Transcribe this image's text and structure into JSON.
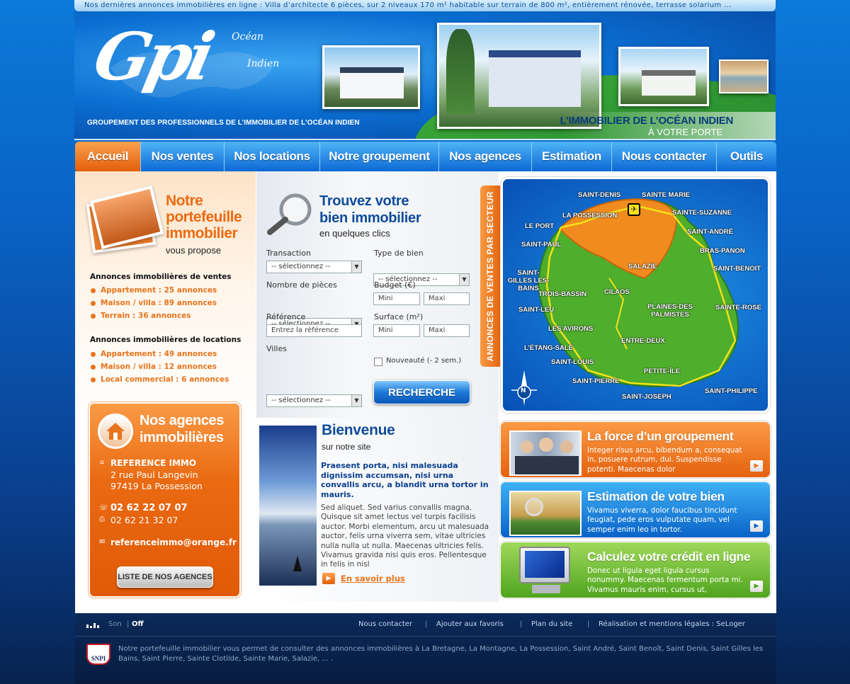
{
  "ticker": "Nos dernières annonces immobilières en ligne : Villa d’architecte 6 pièces, sur 2 niveaux 170 m² habitable sur terrain de 800 m², entièrement rénovée, terrasse solarium ...",
  "header": {
    "logo_text": "Gpi",
    "logo_ocean": "Océan",
    "logo_indien": "Indien",
    "tagline": "GROUPEMENT DES PROFESSIONNELS DE L’IMMOBILIER DE L’OCÉAN INDIEN",
    "slogan_line1": "L’IMMOBILIER DE L’OCÉAN INDIEN",
    "slogan_line2": "À VOTRE PORTE"
  },
  "nav": [
    "Accueil",
    "Nos ventes",
    "Nos locations",
    "Notre groupement",
    "Nos agences",
    "Estimation",
    "Nous contacter",
    "Outils"
  ],
  "portfolio": {
    "title_line1": "Notre",
    "title_line2": "portefeuille",
    "title_line3": "immobilier",
    "subtitle": "vous propose",
    "sales_title": "Annonces immobilières de ventes",
    "sales": [
      "Appartement : 25 annonces",
      "Maison / villa : 89 annonces",
      "Terrain : 36 annonces"
    ],
    "rentals_title": "Annonces immobilières de locations",
    "rentals": [
      "Appartement : 49 annonces",
      "Maison / villa : 12 annonces",
      "Local commercial : 6 annonces"
    ]
  },
  "agencies": {
    "title_line1": "Nos agences",
    "title_line2": "immobilières",
    "name": "REFERENCE IMMO",
    "address1": "2 rue Paul Langevin",
    "address2": "97419 La Possession",
    "phone": "02 62 22 07 07",
    "fax": "02 62 21 32 07",
    "email": "referenceimmo@orange.fr",
    "button": "LISTE DE NOS AGENCES"
  },
  "search": {
    "title_line1": "Trouvez votre",
    "title_line2": "bien immobilier",
    "subtitle": "en quelques clics",
    "transaction_label": "Transaction",
    "transaction_value": "-- sélectionnez --",
    "type_label": "Type de bien",
    "type_value": "-- sélectionnez --",
    "rooms_label": "Nombre de pièces",
    "rooms_value": "-- sélectionnez --",
    "budget_label": "Budget (€)",
    "budget_min": "Mini",
    "budget_max": "Maxi",
    "ref_label": "Référence",
    "ref_placeholder": "Entrez la référence",
    "surface_label": "Surface (m²)",
    "surface_min": "Mini",
    "surface_max": "Maxi",
    "cities_label": "Villes",
    "cities_value": "-- sélectionnez --",
    "new_label": "Nouveauté (- 2 sem.)",
    "button": "RECHERCHE"
  },
  "sector_tab": "ANNONCES DE VENTES  PAR SECTEUR",
  "map": {
    "cities": [
      "SAINT-DENIS",
      "SAINTE MARIE",
      "LA POSSESSION",
      "SAINTE-SUZANNE",
      "LE PORT",
      "SAINT-ANDRÉ",
      "SAINT-PAUL",
      "BRAS-PANON",
      "SALAZIE",
      "SAINT-BENOIT",
      "SAINT-GILLES LES-BAINS",
      "TROIS-BASSIN",
      "CILAOS",
      "SAINT-LEU",
      "PLAINES-DES PALMISTES",
      "SAINTE-ROSE",
      "LES AVIRONS",
      "ENTRE-DEUX",
      "L’ÉTANG-SALÉ",
      "SAINT-LOUIS",
      "PETITE-ÎLE",
      "SAINT-PIERRE",
      "SAINT-PHILIPPE",
      "SAINT-JOSEPH"
    ],
    "compass": "N"
  },
  "welcome": {
    "title": "Bienvenue",
    "subtitle": "sur notre site",
    "lead": "Praesent porta, nisi malesuada dignissim accumsan, nisi urna convallis arcu, a blandit urna tortor in mauris.",
    "body": "Sed aliquet. Sed varius convallis magna. Quisque sit amet lectus vel turpis facilisis auctor. Morbi elementum, arcu ut malesuada auctor, felis urna viverra sem, vitae ultricies nulla nulla ut nulla. Maecenas ultricies felis. Vivamus gravida nisi quis eros. Pellentesque in felis in nisl",
    "more": "En savoir plus"
  },
  "promos": [
    {
      "title": "La force d’un groupement",
      "text": "Integer risus arcu, bibendum a, consequat in, posuere rutrum, dui. Suspendisse potenti. Maecenas dolor"
    },
    {
      "title": "Estimation de votre bien",
      "text": "Vivamus viverra, dolor faucibus tincidunt feugiat, pede eros vulputate quam, vel semper enim leo in tortor."
    },
    {
      "title": "Calculez votre crédit en ligne",
      "text": "Donec ut ligula eget ligula cursus nonummy. Maecenas fermentum porta mi. Vivamus mauris enim, cursus ut,"
    }
  ],
  "footer": {
    "sound_label": "Son",
    "sound_state": "Off",
    "links": [
      "Nous contacter",
      "Ajouter aux favoris",
      "Plan du site",
      "Réalisation et mentions légales : SeLoger"
    ],
    "separator": "|",
    "snpi": "SNPI",
    "text": "Notre portefeuille immobilier vous permet de consulter des annonces immobilières à  La Bretagne, La Montagne, La Possession, Saint André, Saint Benoît, Saint Denis, Saint Gilles les Bains, Saint Pierre, Sainte Clotilde, Sainte Marie, Salazie, ... ."
  },
  "colors": {
    "orange": "#e8741c",
    "blue": "#0f4b9a",
    "green": "#5fb62c"
  }
}
